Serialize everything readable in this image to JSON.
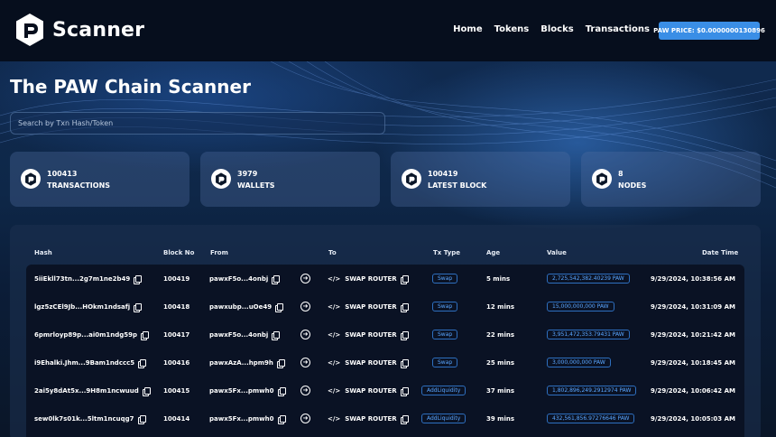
{
  "brand": {
    "name": "Scanner"
  },
  "nav": {
    "links": [
      "Home",
      "Tokens",
      "Blocks",
      "Transactions"
    ],
    "price_label": "PAW PRICE: $0.0000000130896"
  },
  "hero": {
    "title": "The PAW Chain Scanner",
    "search_placeholder": "Search by Txn Hash/Token"
  },
  "stats": [
    {
      "value": "100413",
      "label": "TRANSACTIONS"
    },
    {
      "value": "3979",
      "label": "WALLETS"
    },
    {
      "value": "100419",
      "label": "LATEST BLOCK"
    },
    {
      "value": "8",
      "label": "NODES"
    }
  ],
  "table": {
    "headers": {
      "hash": "Hash",
      "block": "Block No",
      "from": "From",
      "to": "To",
      "type": "Tx Type",
      "age": "Age",
      "value": "Value",
      "date": "Date Time"
    },
    "rows": [
      {
        "hash": "5iiEkll73tn...2g7m1ne2b49",
        "block": "100419",
        "from": "pawxF5o...4onbj",
        "to": "SWAP ROUTER",
        "type": "Swap",
        "age": "5 mins",
        "value": "2,725,542,382.40239 PAW",
        "date": "9/29/2024, 10:38:56 AM"
      },
      {
        "hash": "lgz5zCEl9Jb...HOkm1ndsafj",
        "block": "100418",
        "from": "pawxubp...uOe49",
        "to": "SWAP ROUTER",
        "type": "Swap",
        "age": "12 mins",
        "value": "15,000,000,000 PAW",
        "date": "9/29/2024, 10:31:09 AM"
      },
      {
        "hash": "6pmrloyp89p...ai0m1ndg59p",
        "block": "100417",
        "from": "pawxF5o...4onbj",
        "to": "SWAP ROUTER",
        "type": "Swap",
        "age": "22 mins",
        "value": "3,951,472,353.79431 PAW",
        "date": "9/29/2024, 10:21:42 AM"
      },
      {
        "hash": "i9Ehalki.Jhm...9Bam1ndccc5",
        "block": "100416",
        "from": "pawxAzA...hpm9h",
        "to": "SWAP ROUTER",
        "type": "Swap",
        "age": "25 mins",
        "value": "3,000,000,000 PAW",
        "date": "9/29/2024, 10:18:45 AM"
      },
      {
        "hash": "2ai5y8dAt5x...9H8m1ncwuud",
        "block": "100415",
        "from": "pawx5Fx...pmwh0",
        "to": "SWAP ROUTER",
        "type": "AddLiquidity",
        "age": "37 mins",
        "value": "1,802,896,249.2912974 PAW",
        "date": "9/29/2024, 10:06:42 AM"
      },
      {
        "hash": "sew0lk7s01k...5ltm1ncuqg7",
        "block": "100414",
        "from": "pawx5Fx...pmwh0",
        "to": "SWAP ROUTER",
        "type": "AddLiquidity",
        "age": "39 mins",
        "value": "432,561,856.97276646 PAW",
        "date": "9/29/2024, 10:05:03 AM"
      }
    ]
  }
}
